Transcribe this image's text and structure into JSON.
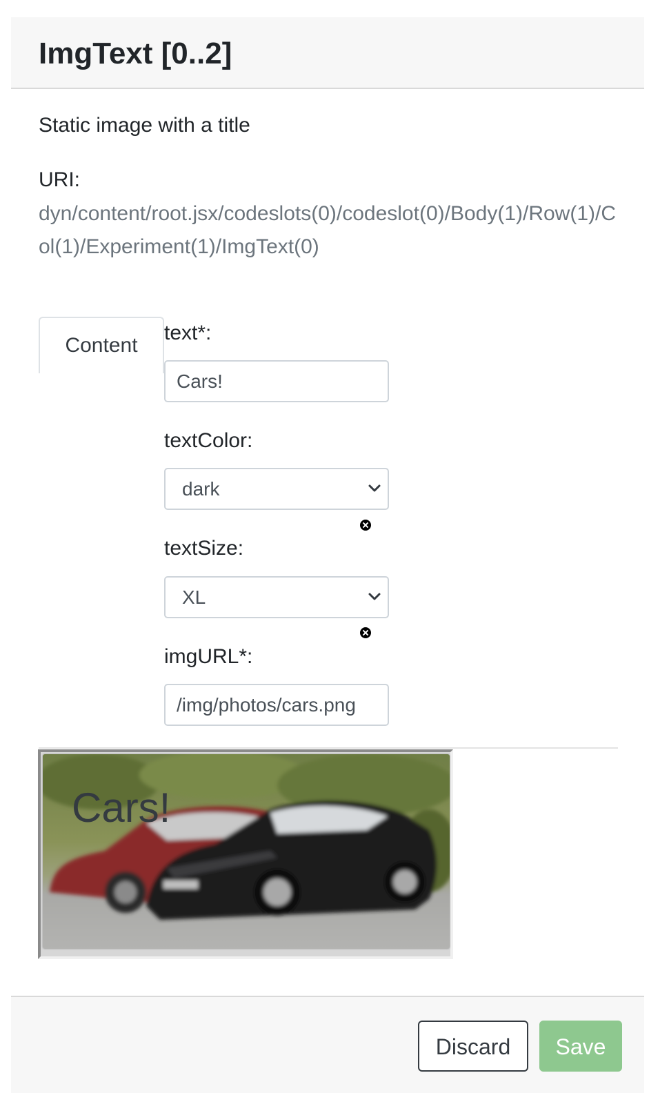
{
  "header": {
    "title": "ImgText [0..2]"
  },
  "description": "Static image with a title",
  "uri": {
    "label": "URI:",
    "value": "dyn/content/root.jsx/codeslots(0)/codeslot(0)/Body(1)/Row(1)/Col(1)/Experiment(1)/ImgText(0)"
  },
  "tabs": [
    {
      "label": "Content",
      "active": true
    }
  ],
  "form": {
    "text": {
      "label": "text*:",
      "value": "Cars!"
    },
    "textColor": {
      "label": "textColor:",
      "selected": "dark"
    },
    "textSize": {
      "label": "textSize:",
      "selected": "XL"
    },
    "imgURL": {
      "label": "imgURL*:",
      "value": "/img/photos/cars.png"
    }
  },
  "preview": {
    "title": "Cars!",
    "image_description_icon": "photo-of-cars"
  },
  "footer": {
    "discard_label": "Discard",
    "save_label": "Save"
  },
  "colors": {
    "header_bg": "#f7f7f7",
    "uri_text": "#6c757d",
    "save_button": "#8ec88f",
    "discard_border": "#343a40"
  }
}
